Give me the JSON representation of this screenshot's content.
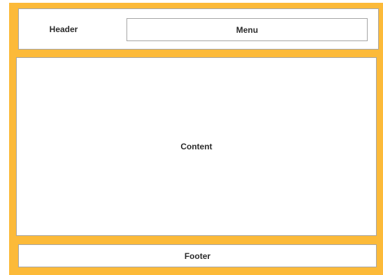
{
  "colors": {
    "frame_background": "#fcba39",
    "box_background": "#ffffff",
    "box_border": "#a6a6a6",
    "text": "#2b2b2b"
  },
  "header": {
    "label": "Header",
    "menu_label": "Menu"
  },
  "content": {
    "label": "Content"
  },
  "footer": {
    "label": "Footer"
  }
}
